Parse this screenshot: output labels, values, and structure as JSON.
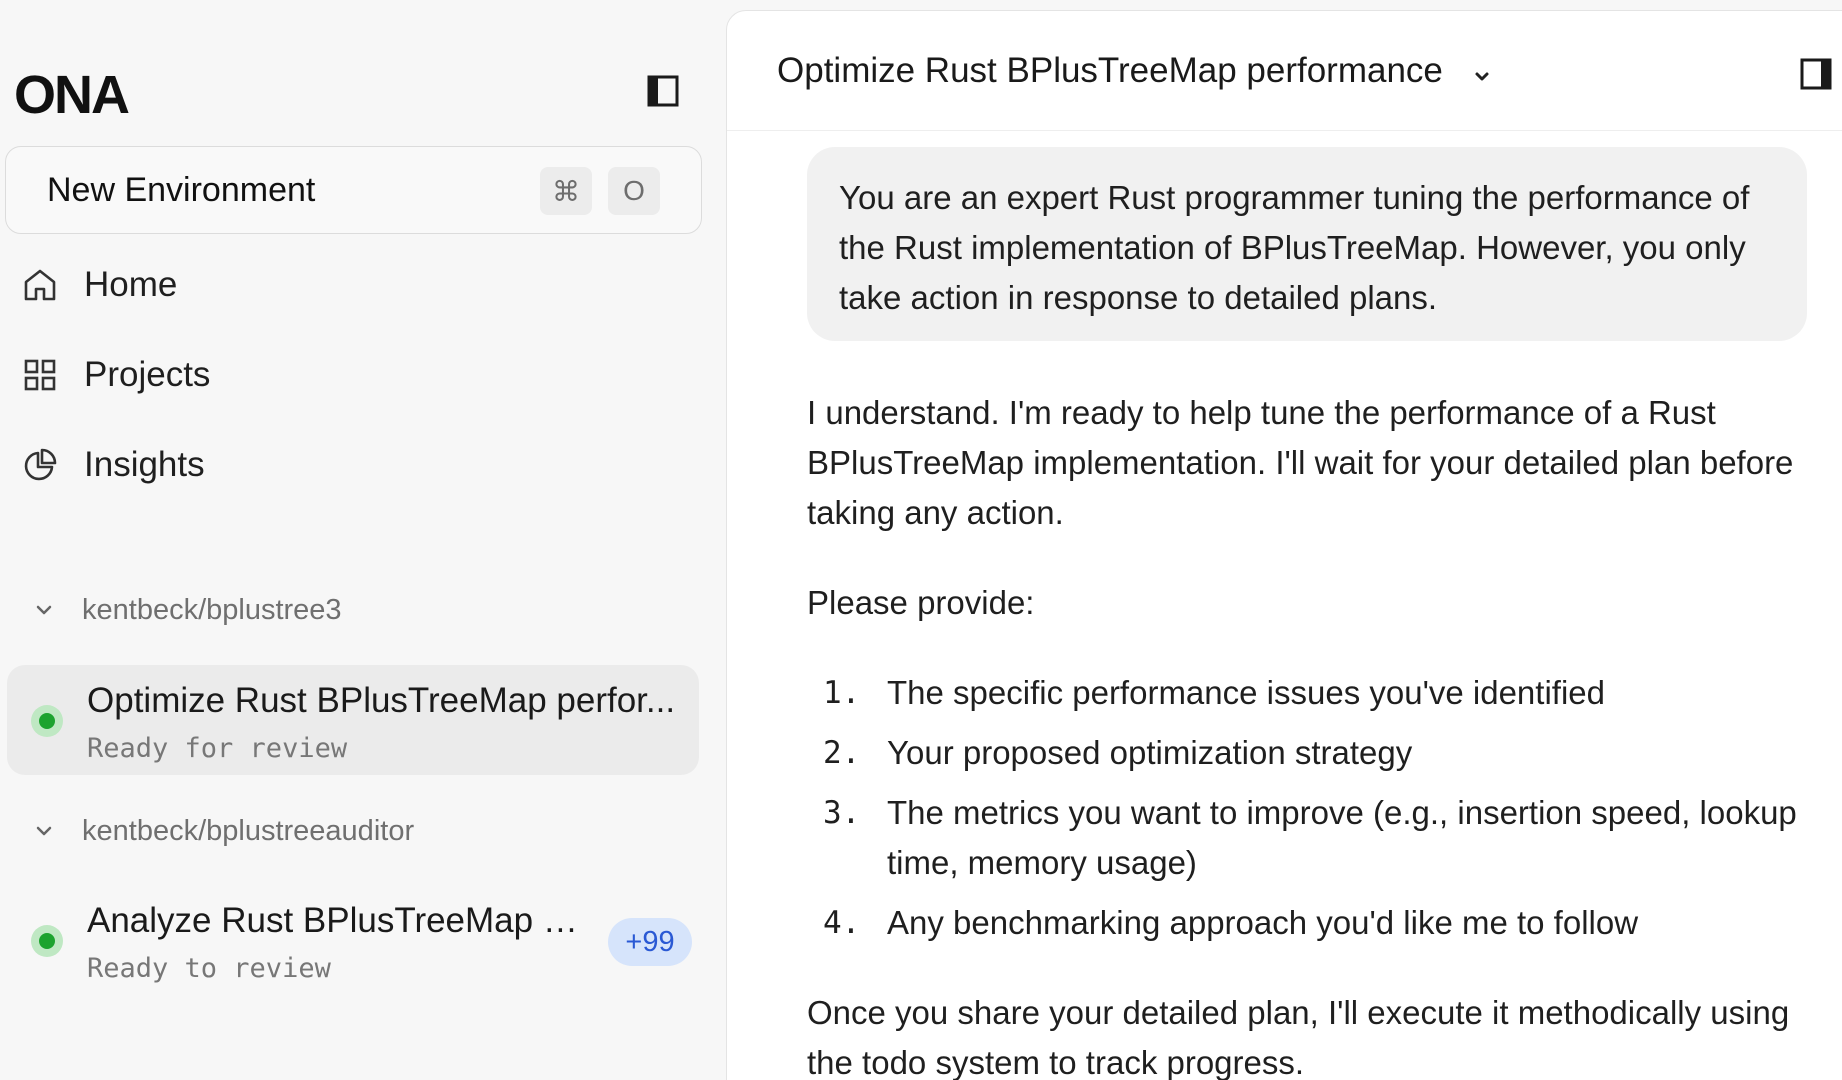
{
  "sidebar": {
    "logo": "ONA",
    "new_environment": {
      "label": "New Environment",
      "shortcut_modifier": "⌘",
      "shortcut_key": "O"
    },
    "nav": [
      {
        "label": "Home",
        "icon": "home-icon"
      },
      {
        "label": "Projects",
        "icon": "grid-icon"
      },
      {
        "label": "Insights",
        "icon": "pie-chart-icon"
      }
    ],
    "groups": [
      {
        "name": "kentbeck/bplustree3",
        "tasks": [
          {
            "title": "Optimize Rust BPlusTreeMap perfor...",
            "status": "Ready for review",
            "active": true
          }
        ]
      },
      {
        "name": "kentbeck/bplustreeauditor",
        "tasks": [
          {
            "title": "Analyze Rust BPlusTreeMap p...",
            "status": "Ready to review",
            "badge": "+99",
            "active": false
          }
        ]
      }
    ]
  },
  "main": {
    "title": "Optimize Rust BPlusTreeMap performance",
    "user_message": "You are an expert Rust programmer tuning the performance of the Rust implementation of BPlusTreeMap. However, you only take action in response to detailed plans.",
    "assistant": {
      "intro": "I understand. I'm ready to help tune the performance of a Rust BPlusTreeMap implementation. I'll wait for your detailed plan before taking any action.",
      "prompt": "Please provide:",
      "items": [
        {
          "num": "1.",
          "text": "The specific performance issues you've identified"
        },
        {
          "num": "2.",
          "text": "Your proposed optimization strategy"
        },
        {
          "num": "3.",
          "text": "The metrics you want to improve (e.g., insertion speed, lookup time, memory usage)"
        },
        {
          "num": "4.",
          "text": "Any benchmarking approach you'd like me to follow"
        }
      ],
      "closing": "Once you share your detailed plan, I'll execute it methodically using the todo system to track progress."
    }
  },
  "colors": {
    "status_green": "#1da32f",
    "badge_bg": "#d6e4fb",
    "badge_text": "#2a59d4",
    "active_row": "#ebebeb"
  }
}
